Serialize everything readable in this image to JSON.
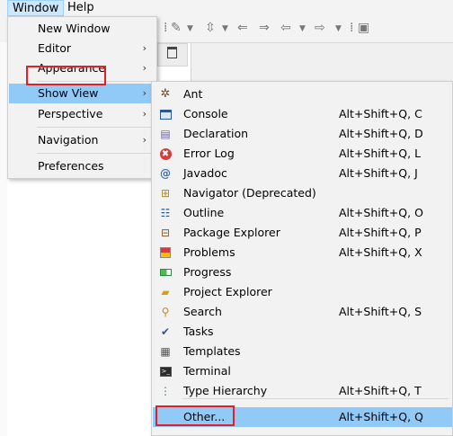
{
  "menubar": {
    "window": "Window",
    "help": "Help"
  },
  "window_menu": {
    "items": [
      {
        "label": "New Window",
        "has_submenu": false
      },
      {
        "label": "Editor",
        "has_submenu": true
      },
      {
        "label": "Appearance",
        "has_submenu": true
      },
      {
        "label": "Show View",
        "has_submenu": true,
        "selected": true
      },
      {
        "label": "Perspective",
        "has_submenu": true
      },
      {
        "label": "Navigation",
        "has_submenu": true
      },
      {
        "label": "Preferences",
        "has_submenu": false
      }
    ]
  },
  "show_view_menu": {
    "items": [
      {
        "label": "Ant",
        "shortcut": "",
        "icon": "ant-icon"
      },
      {
        "label": "Console",
        "shortcut": "Alt+Shift+Q, C",
        "icon": "console-icon"
      },
      {
        "label": "Declaration",
        "shortcut": "Alt+Shift+Q, D",
        "icon": "declaration-icon"
      },
      {
        "label": "Error Log",
        "shortcut": "Alt+Shift+Q, L",
        "icon": "error-log-icon"
      },
      {
        "label": "Javadoc",
        "shortcut": "Alt+Shift+Q, J",
        "icon": "javadoc-icon"
      },
      {
        "label": "Navigator (Deprecated)",
        "shortcut": "",
        "icon": "navigator-icon"
      },
      {
        "label": "Outline",
        "shortcut": "Alt+Shift+Q, O",
        "icon": "outline-icon"
      },
      {
        "label": "Package Explorer",
        "shortcut": "Alt+Shift+Q, P",
        "icon": "package-explorer-icon"
      },
      {
        "label": "Problems",
        "shortcut": "Alt+Shift+Q, X",
        "icon": "problems-icon"
      },
      {
        "label": "Progress",
        "shortcut": "",
        "icon": "progress-icon"
      },
      {
        "label": "Project Explorer",
        "shortcut": "",
        "icon": "project-explorer-icon"
      },
      {
        "label": "Search",
        "shortcut": "Alt+Shift+Q, S",
        "icon": "search-icon"
      },
      {
        "label": "Tasks",
        "shortcut": "",
        "icon": "tasks-icon"
      },
      {
        "label": "Templates",
        "shortcut": "",
        "icon": "templates-icon"
      },
      {
        "label": "Terminal",
        "shortcut": "",
        "icon": "terminal-icon"
      },
      {
        "label": "Type Hierarchy",
        "shortcut": "Alt+Shift+Q, T",
        "icon": "type-hierarchy-icon"
      },
      {
        "label": "Other...",
        "shortcut": "Alt+Shift+Q, Q",
        "icon": "",
        "selected": true
      }
    ]
  },
  "colors": {
    "highlight": "#91c9f7",
    "menu_bg": "#f2f2f2",
    "annotation_red": "#e1202b"
  }
}
